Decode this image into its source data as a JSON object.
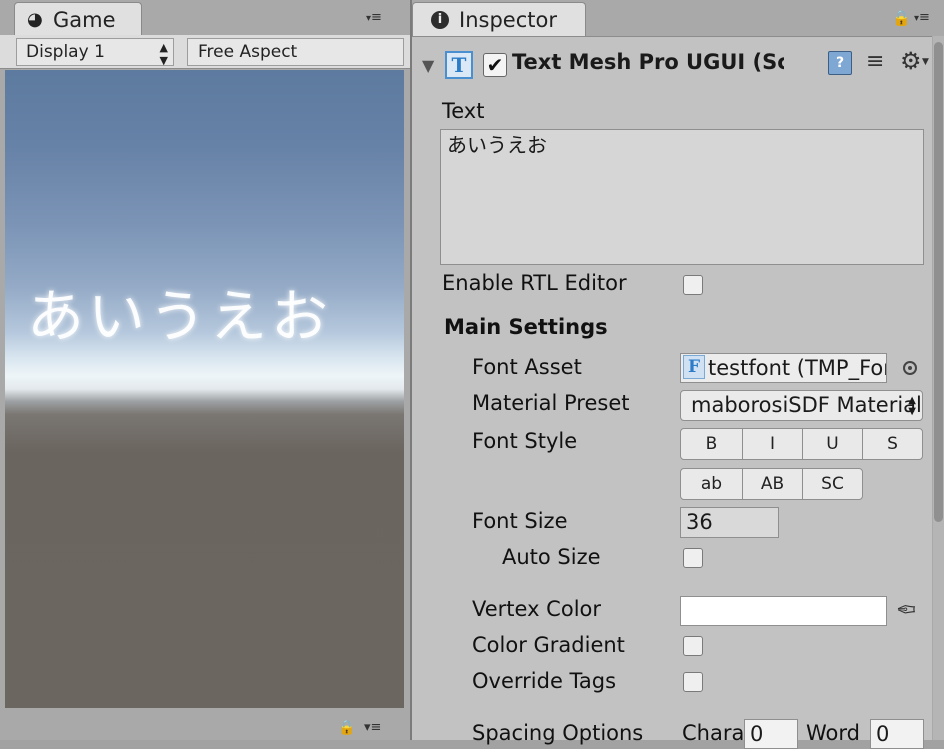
{
  "game": {
    "tab_label": "Game",
    "tab_icon": "pacman-icon",
    "display": "Display 1",
    "aspect": "Free Aspect",
    "rendered_text": "あいうえお"
  },
  "inspector": {
    "tab_label": "Inspector",
    "tab_icon": "info-icon",
    "component": {
      "title": "Text Mesh Pro UGUI (Script)",
      "enabled": true,
      "icon_letter": "T"
    },
    "text_label": "Text",
    "text_value": "あいうえお",
    "enable_rtl_label": "Enable RTL Editor",
    "main_settings_label": "Main Settings",
    "font_asset_label": "Font Asset",
    "font_asset_value": "testfont (TMP_Font Asset)",
    "font_asset_icon_letter": "F",
    "material_preset_label": "Material Preset",
    "material_preset_value": "maborosiSDF Material",
    "font_style_label": "Font Style",
    "style_buttons_row1": [
      "B",
      "I",
      "U",
      "S"
    ],
    "style_buttons_row2": [
      "ab",
      "AB",
      "SC"
    ],
    "font_size_label": "Font Size",
    "font_size_value": "36",
    "auto_size_label": "Auto Size",
    "vertex_color_label": "Vertex Color",
    "vertex_color_value": "#ffffff",
    "color_gradient_label": "Color Gradient",
    "override_tags_label": "Override Tags",
    "spacing_options_label": "Spacing Options",
    "spacing_char_label": "Chara",
    "spacing_char_value": "0",
    "spacing_word_label": "Word",
    "spacing_word_value": "0"
  }
}
